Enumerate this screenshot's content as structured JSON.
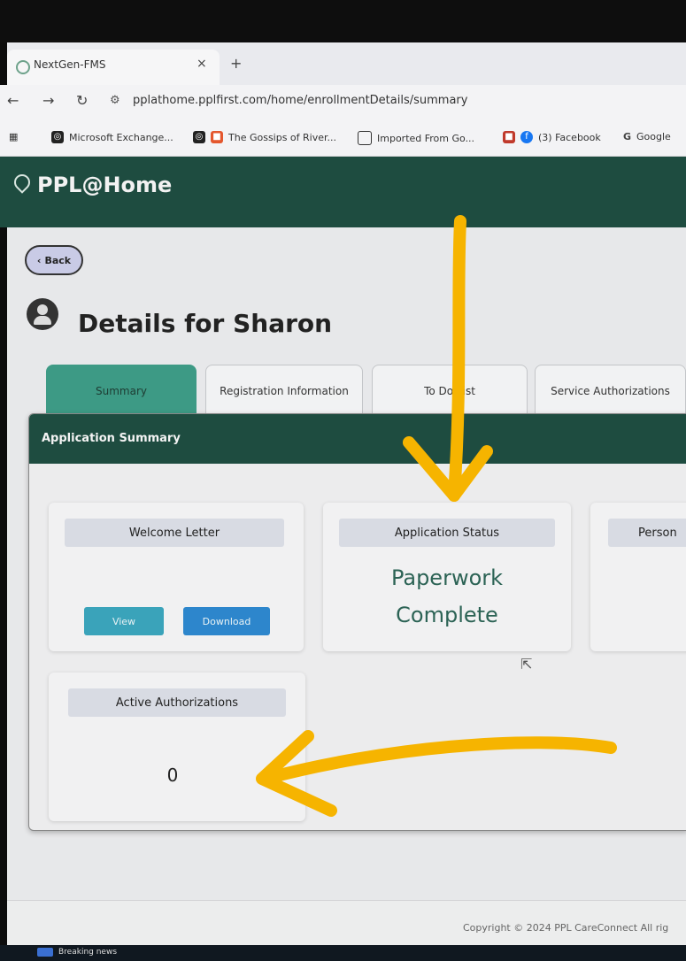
{
  "browser": {
    "tab_title": "NextGen-FMS",
    "tab_close": "×",
    "new_tab": "+",
    "url": "pplathome.pplfirst.com/home/enrollmentDetails/summary",
    "bookmarks": [
      "Microsoft Exchange...",
      "The Gossips of River...",
      "Imported From Go...",
      "(3) Facebook",
      "Google"
    ]
  },
  "app": {
    "logo": "PPL@Home",
    "back_label": "Back",
    "page_title": "Details for Sharon",
    "tabs": [
      {
        "label": "Summary",
        "active": true
      },
      {
        "label": "Registration Information",
        "active": false
      },
      {
        "label": "To Do List",
        "active": false
      },
      {
        "label": "Service Authorizations",
        "active": false
      }
    ],
    "summary_title": "Application Summary",
    "welcome_letter": {
      "label": "Welcome Letter",
      "view": "View",
      "download": "Download"
    },
    "application_status": {
      "label": "Application Status",
      "line1": "Paperwork",
      "line2": "Complete"
    },
    "person_label": "Person",
    "active_authorizations": {
      "label": "Active Authorizations",
      "count": "0"
    },
    "footer": "Copyright © 2024 PPL CareConnect All rig"
  },
  "taskbar": {
    "news": "Breaking news"
  },
  "colors": {
    "header": "#1e4c40",
    "active_tab": "#3d9a85",
    "annotation": "#f6b400"
  }
}
